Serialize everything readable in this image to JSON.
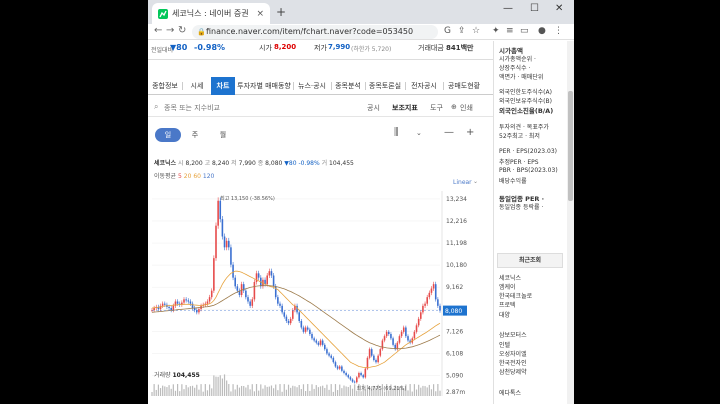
{
  "browser": {
    "tab_title": "세코닉스 : 네이버 증권",
    "tab_close": "×",
    "new_tab": "+",
    "min": "—",
    "max": "☐",
    "close": "✕",
    "back": "←",
    "forward": "→",
    "reload": "↻",
    "url": "finance.naver.com/item/fchart.naver?code=053450",
    "ext_icons": [
      "G",
      "⇪",
      "☆",
      "✦",
      "≡",
      "▭",
      "●",
      "⋮"
    ]
  },
  "pricebar": {
    "prev_label": "전일대비",
    "change": "▼80",
    "rate": "-0.98%",
    "open_label": "시가",
    "open": "8,200",
    "low_label": "저가",
    "low": "7,990",
    "low_sub": "(하한가 5,720)",
    "turnover_label": "거래대금",
    "turnover": "841백만"
  },
  "subnav": {
    "tabs": [
      "종합정보",
      "시세",
      "차트",
      "투자자별 매매동향",
      "뉴스·공시",
      "종목분석",
      "종목토론실",
      "전자공시",
      "공매도현황"
    ]
  },
  "searchrow": {
    "placeholder": "종목 또는 지수비교",
    "links": [
      "공시",
      "보조지표",
      "도구",
      "인쇄"
    ]
  },
  "period": {
    "options": [
      "일",
      "주",
      "월"
    ]
  },
  "chart_info": {
    "name": "세코닉스",
    "open_k": "시",
    "open": "8,200",
    "high_k": "고",
    "high": "8,240",
    "low_k": "저",
    "low": "7,990",
    "close_k": "종",
    "close": "8,080",
    "change": "▼80",
    "rate": "-0.98%",
    "vol_k": "거",
    "vol": "104,455",
    "ma_label": "이동평균",
    "ma_short": "5",
    "ma_mid": "20",
    "ma_mid2": "60",
    "ma_long": "120",
    "scale_mode": "Linear",
    "volume_label": "거래량",
    "volume": "104,455"
  },
  "chart_data": {
    "type": "line",
    "yticks": [
      5090,
      6108,
      7126,
      8144,
      9162,
      10180,
      11198,
      12216,
      13234
    ],
    "ytick_labels": [
      "5,090",
      "6,108",
      "7,126",
      "8,144",
      "9,162",
      "10,180",
      "11,198",
      "12,216",
      "13,234"
    ],
    "ylim": [
      4600,
      13600
    ],
    "current_price": 8080,
    "current_label": "8,080",
    "high_note": "최고 13,150 (-38.56%)",
    "low_note": "최저 4,775 (69.21%)",
    "vol_tick": "2.87m",
    "close": [
      8100,
      8200,
      8250,
      8150,
      8300,
      8400,
      8350,
      8250,
      8200,
      8100,
      8300,
      8500,
      8400,
      8350,
      8450,
      8600,
      8550,
      8500,
      8400,
      8200,
      8100,
      8000,
      8150,
      8300,
      8350,
      8400,
      8500,
      8700,
      9000,
      10500,
      12000,
      13150,
      12300,
      11500,
      11000,
      11300,
      11000,
      10200,
      9600,
      9200,
      9000,
      8800,
      9300,
      9000,
      8700,
      8500,
      8300,
      8600,
      9400,
      9800,
      9600,
      9200,
      9500,
      9300,
      9700,
      9900,
      9700,
      9200,
      8700,
      8400,
      8300,
      8000,
      7800,
      7600,
      7500,
      7700,
      8100,
      8300,
      8000,
      7600,
      7300,
      7100,
      7300,
      7200,
      7000,
      6800,
      6700,
      6600,
      6500,
      6700,
      6500,
      6300,
      6100,
      6000,
      5900,
      5700,
      5500,
      5400,
      5500,
      5300,
      5200,
      5100,
      5000,
      4900,
      4800,
      4775,
      5000,
      5200,
      5100,
      5000,
      5400,
      5900,
      6300,
      6000,
      5800,
      5700,
      6000,
      6300,
      6700,
      6900,
      7100,
      7000,
      6800,
      6500,
      6300,
      6600,
      6900,
      7100,
      7300,
      6900,
      6700,
      6600,
      6800,
      7100,
      7400,
      7700,
      8000,
      8300,
      8400,
      8700,
      8900,
      9100,
      9300,
      8600,
      8300,
      8080
    ],
    "ma20": [
      8200,
      8210,
      8220,
      8230,
      8250,
      8270,
      8290,
      8300,
      8310,
      8320,
      8330,
      8340,
      8350,
      8360,
      8360,
      8370,
      8370,
      8370,
      8360,
      8350,
      8340,
      8330,
      8320,
      8320,
      8330,
      8350,
      8370,
      8400,
      8450,
      8550,
      8700,
      8900,
      9100,
      9300,
      9450,
      9600,
      9700,
      9800,
      9850,
      9900,
      9900,
      9880,
      9850,
      9800,
      9750,
      9700,
      9650,
      9600,
      9550,
      9500,
      9450,
      9400,
      9350,
      9300,
      9250,
      9200,
      9180,
      9150,
      9100,
      9050,
      8950,
      8850,
      8750,
      8650,
      8550,
      8450,
      8350,
      8300,
      8200,
      8100,
      8000,
      7900,
      7800,
      7700,
      7600,
      7500,
      7400,
      7300,
      7200,
      7100,
      7000,
      6900,
      6800,
      6700,
      6600,
      6500,
      6400,
      6300,
      6200,
      6100,
      6000,
      5900,
      5800,
      5700,
      5650,
      5600,
      5550,
      5500,
      5480,
      5460,
      5450,
      5450,
      5460,
      5480,
      5500,
      5520,
      5550,
      5600,
      5650,
      5700,
      5780,
      5860,
      5940,
      6020,
      6100,
      6180,
      6260,
      6340,
      6420,
      6500,
      6560,
      6620,
      6680,
      6740,
      6800,
      6860,
      6920,
      6980,
      7040,
      7100,
      7170,
      7240,
      7310,
      7380,
      7440,
      7500
    ],
    "ma60": [
      8000,
      8010,
      8020,
      8030,
      8040,
      8050,
      8060,
      8070,
      8080,
      8090,
      8100,
      8110,
      8120,
      8130,
      8140,
      8150,
      8160,
      8170,
      8180,
      8190,
      8200,
      8210,
      8220,
      8230,
      8240,
      8250,
      8260,
      8280,
      8300,
      8330,
      8370,
      8420,
      8480,
      8540,
      8600,
      8660,
      8720,
      8780,
      8840,
      8890,
      8940,
      8980,
      9020,
      9060,
      9090,
      9120,
      9150,
      9170,
      9190,
      9210,
      9220,
      9230,
      9240,
      9240,
      9240,
      9230,
      9220,
      9210,
      9190,
      9170,
      9140,
      9110,
      9080,
      9040,
      9000,
      8960,
      8910,
      8860,
      8810,
      8760,
      8700,
      8640,
      8580,
      8520,
      8460,
      8400,
      8330,
      8260,
      8190,
      8120,
      8050,
      7980,
      7910,
      7840,
      7770,
      7700,
      7630,
      7560,
      7490,
      7420,
      7350,
      7280,
      7210,
      7140,
      7070,
      7000,
      6940,
      6880,
      6820,
      6760,
      6700,
      6650,
      6600,
      6560,
      6520,
      6480,
      6450,
      6420,
      6400,
      6380,
      6360,
      6350,
      6340,
      6330,
      6320,
      6320,
      6320,
      6330,
      6340,
      6350,
      6370,
      6390,
      6410,
      6440,
      6470,
      6500,
      6540,
      6580,
      6620,
      6660,
      6700,
      6750,
      6800,
      6850,
      6900,
      6950
    ]
  },
  "sidebar": {
    "line1": "시가총액",
    "line2": "시가총액순위 ·",
    "line3": "상장주식수 ·",
    "line4": "액면가 · 매매단위",
    "line5": "외국인한도주식수(A)",
    "line6": "외국인보유주식수(B)",
    "line7": "외국인소진율(B/A)",
    "line8": "투자의견 · 목표주가",
    "line9": "52주최고 · 최저",
    "line10": "PER · EPS(2023.03)",
    "line11": "추정PER · EPS",
    "line12": "PBR · BPS(2023.03)",
    "line13": "배당수익률",
    "line14": "동일업종 PER ·",
    "line15": "동일업종 등락률 ·",
    "recent_title": "최근조회",
    "recent": [
      "세코닉스",
      "엠케이",
      "한국테크놀로",
      "프로텍",
      "대양"
    ],
    "recent2": [
      "삼보모터스",
      "인텔",
      "오성자이엘",
      "한국전자인",
      "삼천당제약"
    ],
    "recent3": "에다톡스"
  }
}
